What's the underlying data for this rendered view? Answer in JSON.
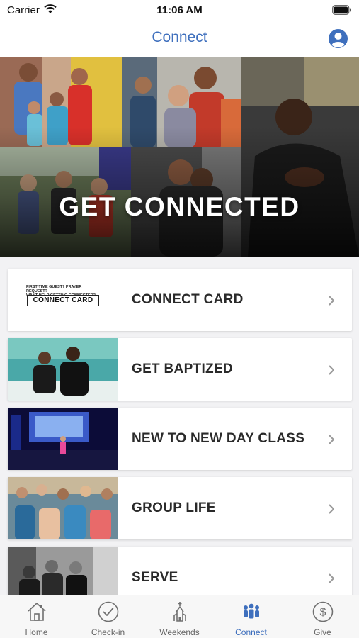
{
  "status_bar": {
    "carrier": "Carrier",
    "time": "11:06 AM",
    "wifi_icon": "wifi-icon",
    "battery_icon": "battery-icon"
  },
  "nav": {
    "title": "Connect",
    "profile_icon": "user-profile-icon",
    "accent_color": "#3e6fbd"
  },
  "hero": {
    "title": "GET CONNECTED"
  },
  "connect_card_thumb": {
    "small_text_line1": "FIRST-TIME GUEST? PRAYER REQUEST?",
    "small_text_line2": "WANT HELP GETTING CONNECTED?",
    "box_text": "CONNECT CARD"
  },
  "list": {
    "items": [
      {
        "label": "CONNECT CARD",
        "icon": "chevron-right-icon"
      },
      {
        "label": "GET BAPTIZED",
        "icon": "chevron-right-icon"
      },
      {
        "label": "NEW TO NEW DAY CLASS",
        "icon": "chevron-right-icon"
      },
      {
        "label": "GROUP LIFE",
        "icon": "chevron-right-icon"
      },
      {
        "label": "SERVE",
        "icon": "chevron-right-icon"
      }
    ]
  },
  "tabs": [
    {
      "label": "Home",
      "icon": "home-icon"
    },
    {
      "label": "Check-in",
      "icon": "check-circle-icon"
    },
    {
      "label": "Weekends",
      "icon": "church-icon"
    },
    {
      "label": "Connect",
      "icon": "people-group-icon",
      "active": true
    },
    {
      "label": "Give",
      "icon": "dollar-circle-icon"
    }
  ]
}
